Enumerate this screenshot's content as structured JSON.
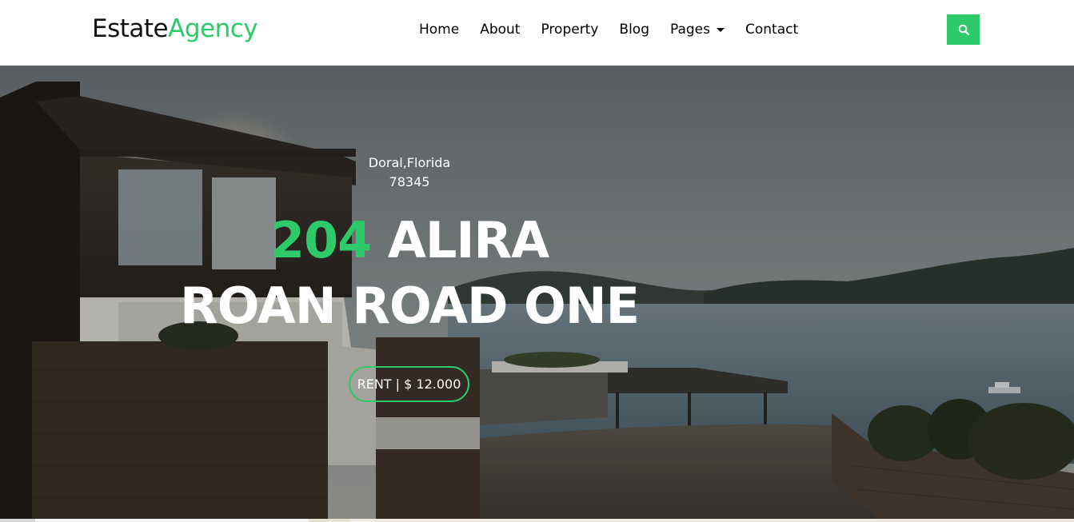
{
  "brand": {
    "part1": "Estate",
    "part2": "Agency"
  },
  "nav": {
    "items": [
      {
        "label": "Home"
      },
      {
        "label": "About"
      },
      {
        "label": "Property"
      },
      {
        "label": "Blog"
      },
      {
        "label": "Pages"
      },
      {
        "label": "Contact"
      }
    ],
    "search_icon": "search-icon"
  },
  "hero": {
    "location_line1": "Doral,Florida",
    "location_line2": "78345",
    "title_number": "204",
    "title_line1_rest": " ALIRA",
    "title_line2": "ROAN ROAD ONE",
    "rent_button": "RENT | $ 12.000"
  },
  "colors": {
    "accent": "#2eca6a",
    "navbar_bg": "#ffffff",
    "nav_text": "#000000"
  }
}
